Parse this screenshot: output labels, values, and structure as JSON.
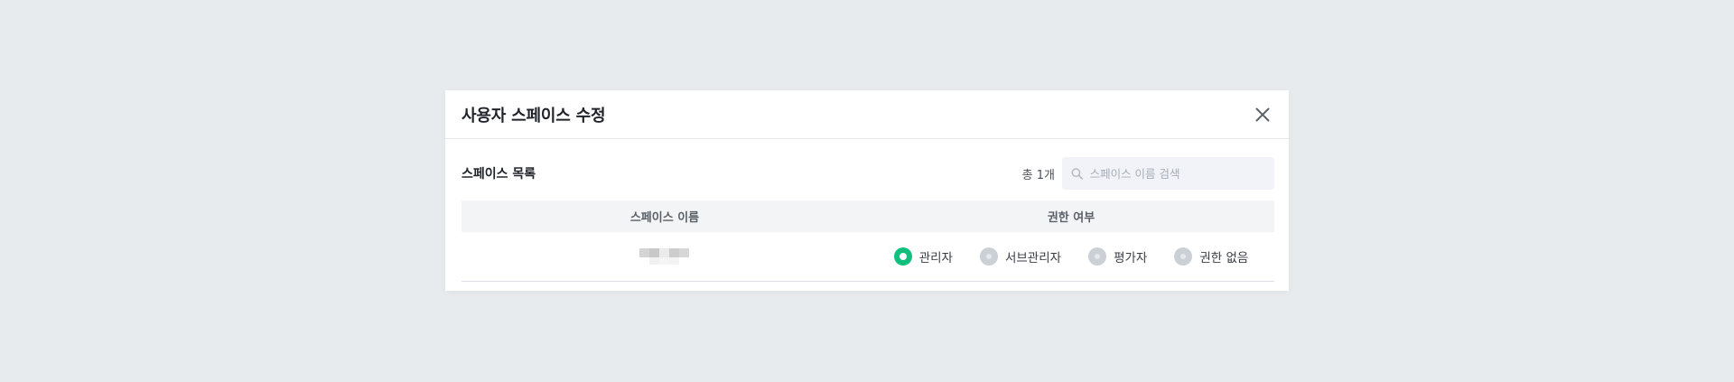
{
  "modal": {
    "title": "사용자 스페이스 수정",
    "close_icon": "close-icon"
  },
  "list": {
    "title": "스페이스 목록",
    "total": "총 1개",
    "search": {
      "placeholder": "스페이스 이름 검색",
      "value": "",
      "icon": "search-icon"
    }
  },
  "table": {
    "headers": [
      "스페이스 이름",
      "권한 여부"
    ],
    "rows": [
      {
        "name": "",
        "options": [
          "관리자",
          "서브관리자",
          "평가자",
          "권한 없음"
        ],
        "selected": "관리자"
      }
    ]
  },
  "colors": {
    "accent": "#0fbf7b",
    "background": "#e8ebee",
    "radio_inactive": "#cbcfd6"
  }
}
